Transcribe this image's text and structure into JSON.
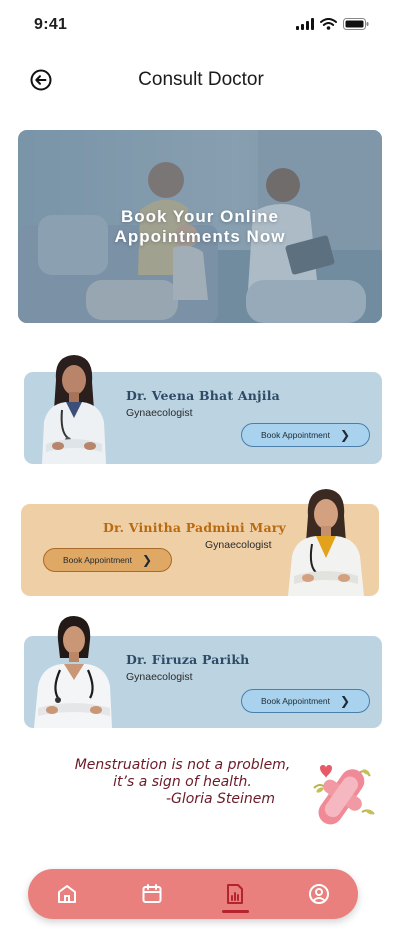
{
  "status_bar": {
    "time": "9:41"
  },
  "header": {
    "title": "Consult Doctor"
  },
  "hero": {
    "line1": "Book Your Online",
    "line2": "Appointments Now"
  },
  "doctors": [
    {
      "name": "Dr. Veena Bhat Anjila",
      "specialty": "Gynaecologist",
      "button_label": "Book Appointment",
      "theme": "blue"
    },
    {
      "name": "Dr. Vinitha Padmini Mary",
      "specialty": "Gynaecologist",
      "button_label": "Book Appointment",
      "theme": "peach"
    },
    {
      "name": "Dr. Firuza Parikh",
      "specialty": "Gynaecologist",
      "button_label": "Book Appointment",
      "theme": "blue"
    }
  ],
  "quote": {
    "line1": "Menstruation is not a problem,",
    "line2": "it’s a sign of health.",
    "author": "-Gloria Steinem"
  },
  "nav": {
    "items": [
      "home-icon",
      "calendar-icon",
      "report-icon",
      "profile-icon"
    ],
    "active_index": 2
  },
  "colors": {
    "card_blue": "#bcd4e2",
    "card_peach": "#efcfa5",
    "name_blue": "#2d4a66",
    "name_peach": "#b86a10",
    "nav_bg": "#e9807d",
    "nav_active": "#b3242e",
    "quote_text": "#6b1b27"
  }
}
